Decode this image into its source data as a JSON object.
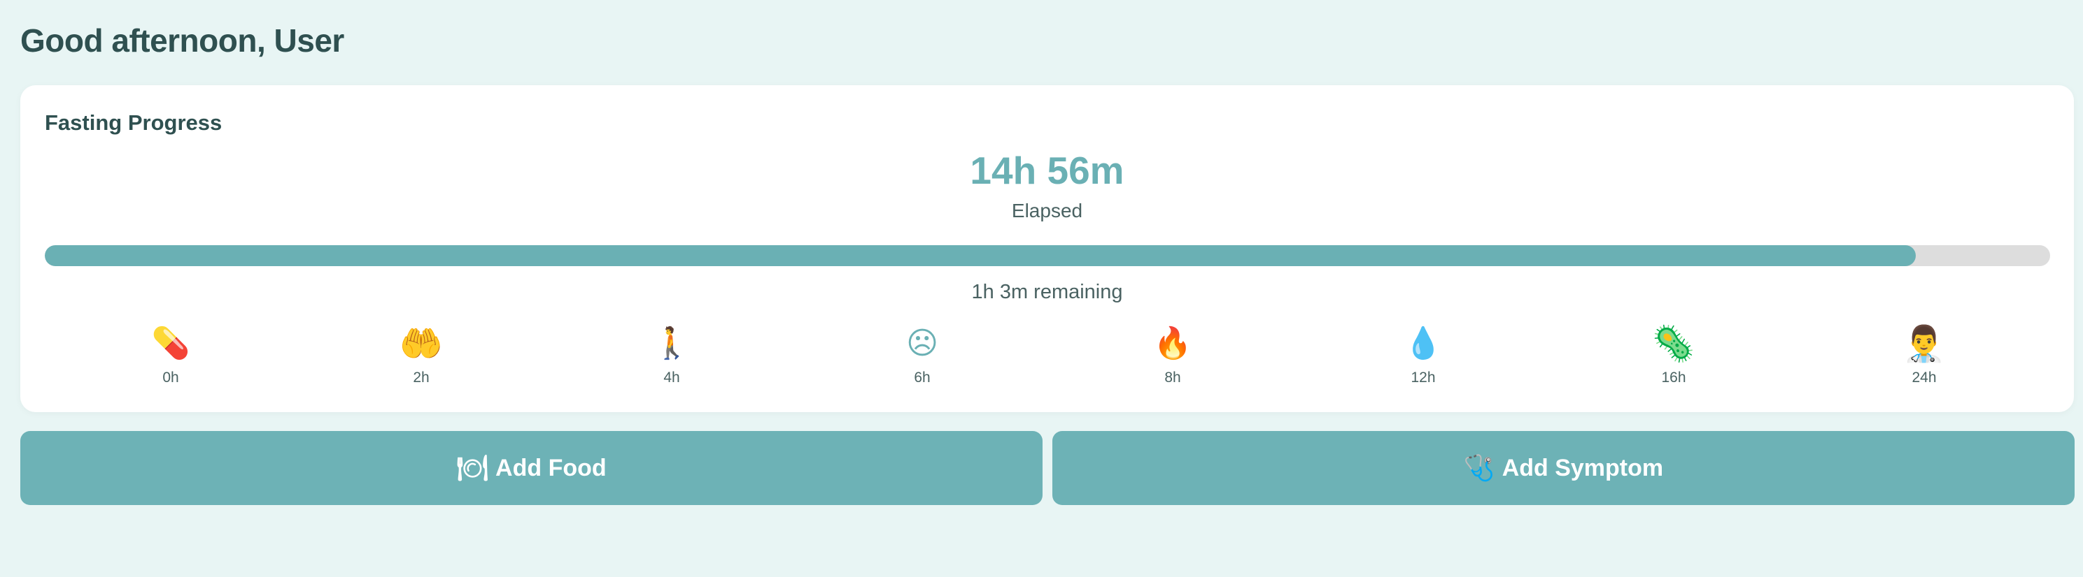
{
  "header": {
    "greeting": "Good afternoon, User"
  },
  "fasting": {
    "title": "Fasting Progress",
    "elapsed": "14h 56m",
    "elapsed_label": "Elapsed",
    "progress_fraction": 0.933,
    "remaining": "1h 3m remaining",
    "milestones": [
      {
        "label": "0h",
        "icon": "pill-icon",
        "glyph": "💊"
      },
      {
        "label": "2h",
        "icon": "hands-icon",
        "glyph": "🤲"
      },
      {
        "label": "4h",
        "icon": "walking-icon",
        "glyph": "🚶"
      },
      {
        "label": "6h",
        "icon": "frown-face-icon",
        "glyph": "☹"
      },
      {
        "label": "8h",
        "icon": "flame-icon",
        "glyph": "🔥"
      },
      {
        "label": "12h",
        "icon": "droplet-icon",
        "glyph": "💧"
      },
      {
        "label": "16h",
        "icon": "microbe-icon",
        "glyph": "🦠"
      },
      {
        "label": "24h",
        "icon": "doctor-icon",
        "glyph": "👨‍⚕️"
      }
    ]
  },
  "actions": {
    "add_food": {
      "icon": "plate-icon",
      "glyph": "🍽",
      "label": "Add Food"
    },
    "add_symptom": {
      "icon": "stethoscope-icon",
      "glyph": "🩺",
      "label": "Add Symptom"
    }
  },
  "colors": {
    "accent": "#6ab0b4",
    "background": "#e8f5f4",
    "track": "#dddddd",
    "text": "#2f5050"
  }
}
